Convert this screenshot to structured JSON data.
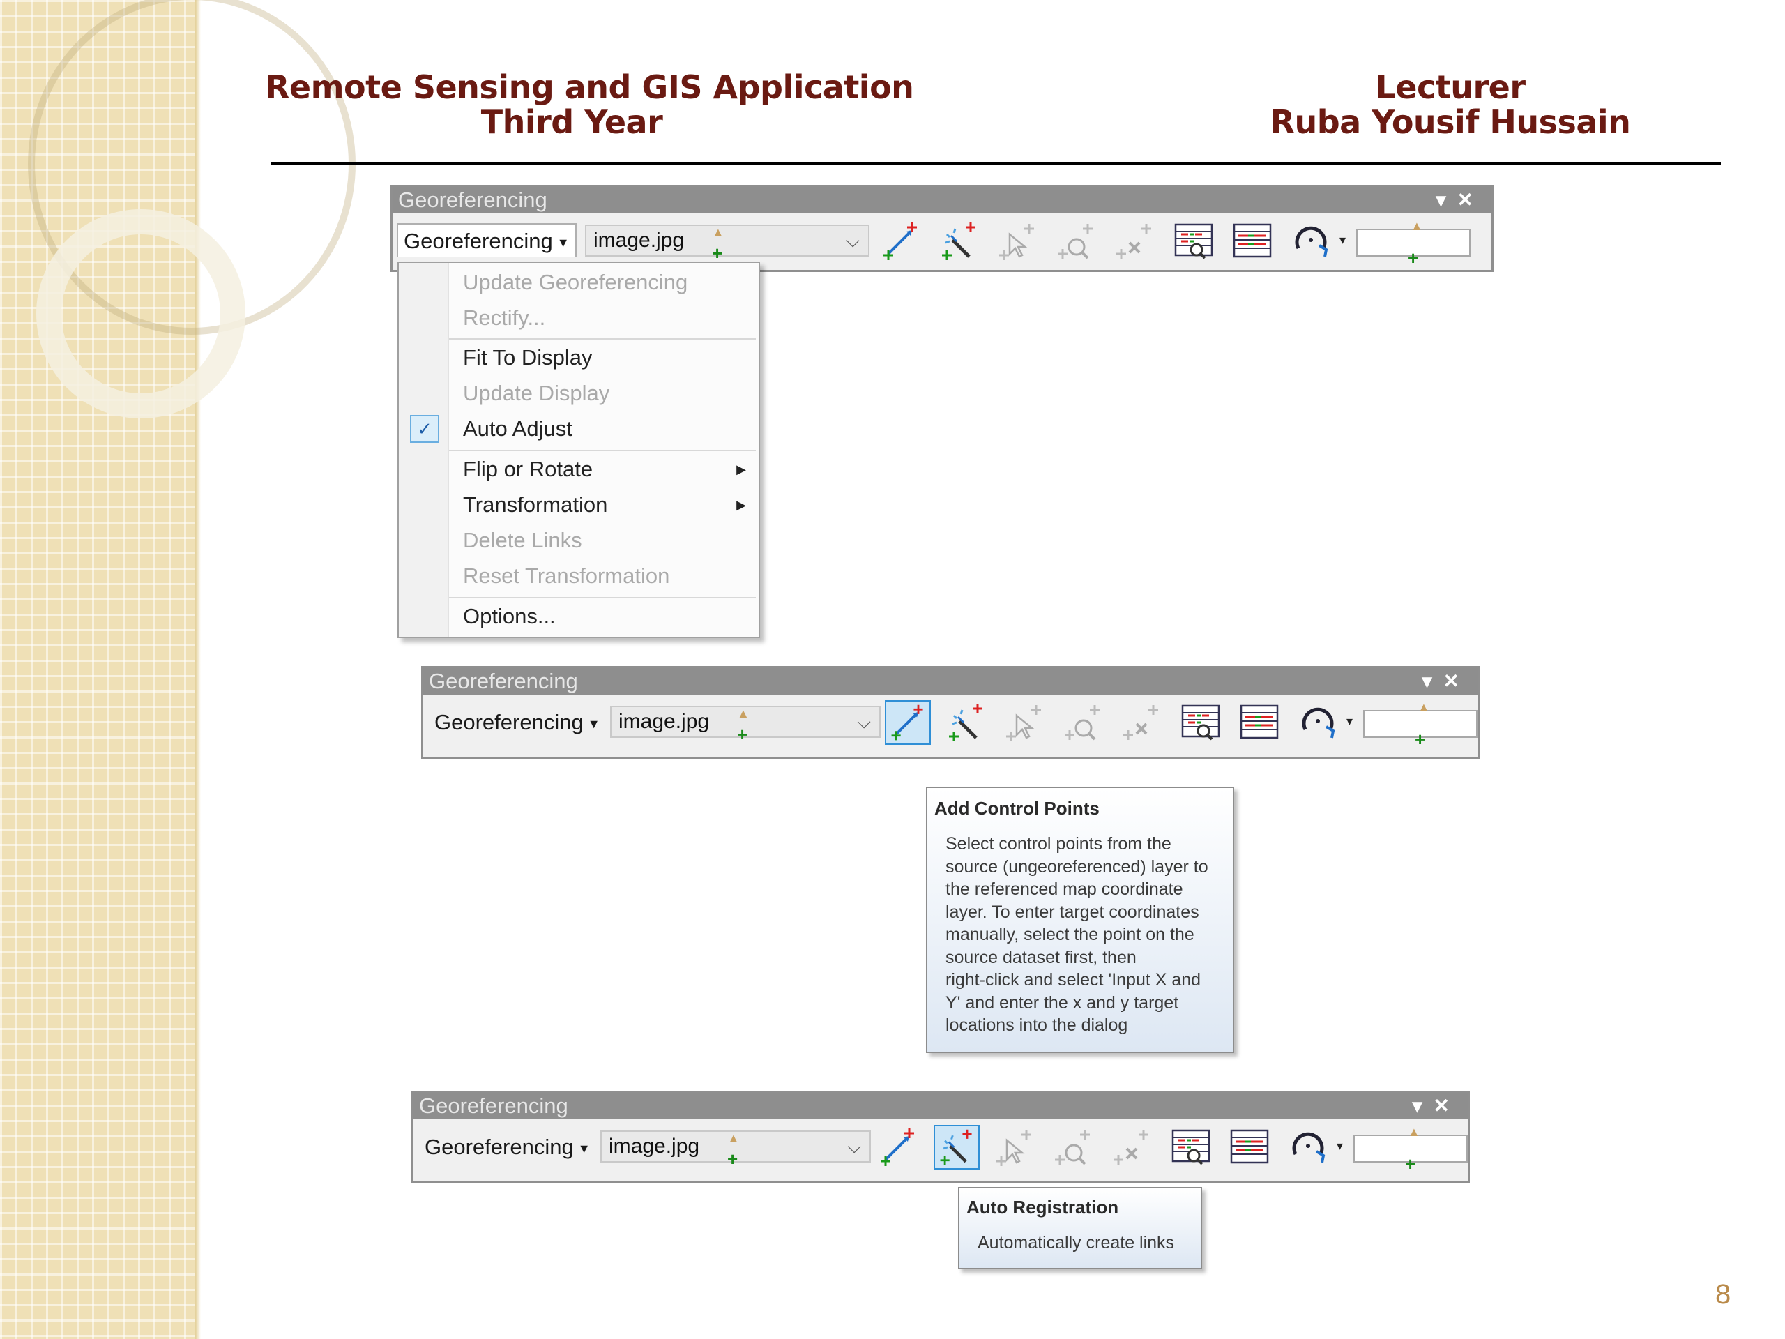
{
  "header": {
    "left_line1": "Remote Sensing and GIS Application",
    "left_line2": "Third Year",
    "right_line1": "Lecturer",
    "right_line2": "Ruba Yousif Hussain"
  },
  "toolbar": {
    "title": "Georeferencing",
    "menu_button": "Georeferencing",
    "layer_value": "image.jpg",
    "window_controls": "▾✕",
    "tools": [
      "add-control-points",
      "auto-registration",
      "select-link",
      "zoom-to-link",
      "delete-link",
      "view-link-table",
      "view-link-table-alt",
      "rotate"
    ]
  },
  "menu": {
    "items": [
      {
        "label": "Update Georeferencing",
        "enabled": false
      },
      {
        "label": "Rectify...",
        "enabled": false
      },
      {
        "label": "Fit To Display",
        "enabled": true
      },
      {
        "label": "Update Display",
        "enabled": false
      },
      {
        "label": "Auto Adjust",
        "enabled": true,
        "checked": true
      },
      {
        "label": "Flip or Rotate",
        "enabled": true,
        "submenu": true
      },
      {
        "label": "Transformation",
        "enabled": true,
        "submenu": true
      },
      {
        "label": "Delete Links",
        "enabled": false
      },
      {
        "label": "Reset Transformation",
        "enabled": false
      },
      {
        "label": "Options...",
        "enabled": true
      }
    ]
  },
  "tooltip_add": {
    "title": "Add Control Points",
    "lines": [
      "Select control points from the",
      "source (ungeoreferenced) layer to",
      "the referenced map coordinate",
      "layer. To enter target coordinates",
      "manually, select the point on the",
      "source dataset first, then",
      "right-click and select 'Input X and",
      "Y' and enter the x and y target",
      "locations into the dialog"
    ]
  },
  "tooltip_auto": {
    "title": "Auto Registration",
    "text": "Automatically create links"
  },
  "slide": {
    "page_number": "8"
  },
  "colors": {
    "heading": "#6a1a12",
    "selected_tool_bg": "#cde6f7",
    "selected_tool_border": "#2f8fd6"
  }
}
